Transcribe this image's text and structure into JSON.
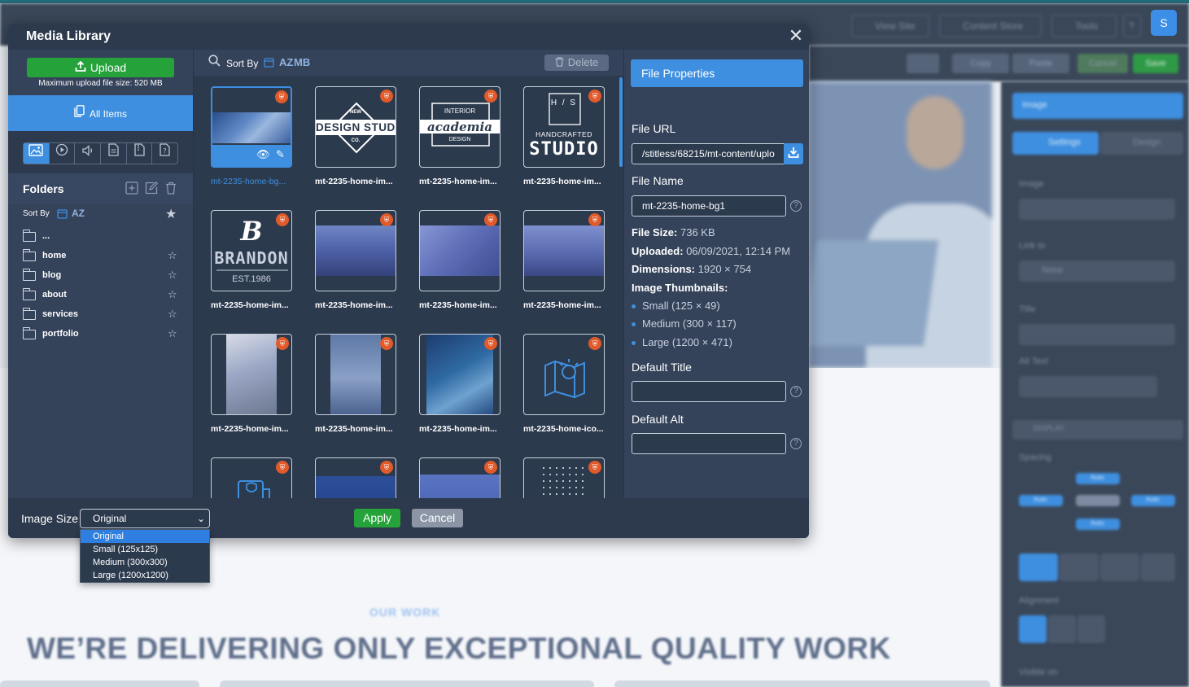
{
  "background": {
    "top_buttons": [
      "View Site",
      "Content Store",
      "Tools",
      "?"
    ],
    "avatar_letter": "S",
    "sub_buttons": [
      "Copy",
      "Paste",
      "Cancel",
      "Save"
    ],
    "our_work": "OUR WORK",
    "headline": "WE’RE DELIVERING ONLY EXCEPTIONAL QUALITY WORK",
    "right_panel": {
      "header": "Image",
      "tabs": [
        "Settings",
        "Design"
      ],
      "labels": [
        "Image",
        "Link to",
        "Title",
        "Alt Text",
        "DISPLAY",
        "Spacing",
        "Alignment",
        "Visible on"
      ],
      "link_select": "None",
      "spacing_values": [
        "Auto",
        "Auto",
        "Auto",
        "Auto"
      ]
    }
  },
  "modal": {
    "title": "Media Library",
    "close_glyph": "✕",
    "sidebar": {
      "upload_label": "Upload",
      "upload_note": "Maximum upload file size: 520 MB",
      "all_items_label": "All Items",
      "filters": [
        "images",
        "video",
        "audio",
        "documents",
        "archives",
        "other"
      ],
      "folders_title": "Folders",
      "sort_by_label": "Sort By",
      "sort_az": "AZ",
      "folders": [
        "...",
        "home",
        "blog",
        "about",
        "services",
        "portfolio"
      ]
    },
    "center": {
      "sort_by_label": "Sort By",
      "sort_az": "AZ",
      "sort_mb": "MB",
      "delete_label": "Delete",
      "items": [
        {
          "name": "mt-2235-home-bg...",
          "kind": "photo"
        },
        {
          "name": "mt-2235-home-im...",
          "kind": "logo",
          "logo": "DESIGN STUDIO"
        },
        {
          "name": "mt-2235-home-im...",
          "kind": "logo",
          "logo": "academia"
        },
        {
          "name": "mt-2235-home-im...",
          "kind": "logo",
          "logo": "STUDIO"
        },
        {
          "name": "mt-2235-home-im...",
          "kind": "logo",
          "logo": "BRANDON"
        },
        {
          "name": "mt-2235-home-im...",
          "kind": "photo"
        },
        {
          "name": "mt-2235-home-im...",
          "kind": "photo"
        },
        {
          "name": "mt-2235-home-im...",
          "kind": "photo"
        },
        {
          "name": "mt-2235-home-im...",
          "kind": "photo"
        },
        {
          "name": "mt-2235-home-im...",
          "kind": "photo"
        },
        {
          "name": "mt-2235-home-im...",
          "kind": "photo"
        },
        {
          "name": "mt-2235-home-ico...",
          "kind": "icon"
        },
        {
          "name": "",
          "kind": "icon"
        },
        {
          "name": "",
          "kind": "photo"
        },
        {
          "name": "",
          "kind": "photo"
        },
        {
          "name": "",
          "kind": "pattern"
        }
      ],
      "logo_extras": {
        "design_studio_top": "NEW",
        "design_studio_bottom": "CO.",
        "academia_top": "INTERIOR",
        "academia_bottom": "DESIGN",
        "studio_letters": "H / S",
        "studio_top": "HANDCRAFTED",
        "brandon_mark": "B",
        "brandon_est": "EST.1986"
      }
    },
    "properties": {
      "header": "File Properties",
      "file_url_label": "File URL",
      "file_url_value": "/stitless/68215/mt-content/uplo",
      "file_name_label": "File Name",
      "file_name_value": "mt-2235-home-bg1",
      "file_size_label": "File Size:",
      "file_size_value": "736 KB",
      "uploaded_label": "Uploaded:",
      "uploaded_value": "06/09/2021, 12:14 PM",
      "dimensions_label": "Dimensions:",
      "dimensions_value": "1920 × 754",
      "thumbnails_label": "Image Thumbnails:",
      "thumbnails": [
        "Small (125 × 49)",
        "Medium (300 × 117)",
        "Large (1200 × 471)"
      ],
      "default_title_label": "Default Title",
      "default_title_value": "",
      "default_alt_label": "Default Alt",
      "default_alt_value": ""
    },
    "footer": {
      "image_size_label": "Image Size",
      "image_size_selected": "Original",
      "apply_label": "Apply",
      "cancel_label": "Cancel"
    },
    "dropdown_options": [
      "Original",
      "Small (125x125)",
      "Medium (300x300)",
      "Large (1200x1200)"
    ]
  },
  "colors": {
    "accent_blue": "#3e8fe0",
    "upload_green": "#25a33a",
    "modal_bg": "#34425a",
    "badge_orange": "#e05a2a"
  }
}
